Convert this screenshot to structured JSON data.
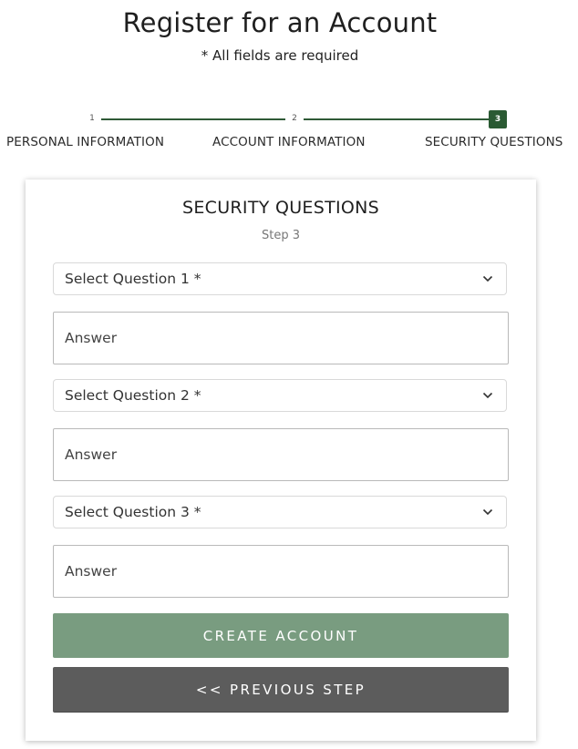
{
  "header": {
    "title": "Register for an Account",
    "subtitle": "* All fields are required"
  },
  "stepper": {
    "steps": [
      {
        "number": "1",
        "label": "PERSONAL INFORMATION"
      },
      {
        "number": "2",
        "label": "ACCOUNT INFORMATION"
      },
      {
        "number": "3",
        "label": "SECURITY QUESTIONS"
      }
    ],
    "active_step": 3,
    "accent_color": "#2a5a33"
  },
  "card": {
    "title": "SECURITY QUESTIONS",
    "step_text": "Step 3",
    "questions": [
      {
        "select_label": "Select Question 1 *",
        "answer_placeholder": "Answer"
      },
      {
        "select_label": "Select Question 2 *",
        "answer_placeholder": "Answer"
      },
      {
        "select_label": "Select Question 3 *",
        "answer_placeholder": "Answer"
      }
    ],
    "create_button": "CREATE ACCOUNT",
    "previous_button": "<< PREVIOUS STEP"
  },
  "colors": {
    "create_button_bg": "#799c80",
    "previous_button_bg": "#5c5c5c"
  }
}
